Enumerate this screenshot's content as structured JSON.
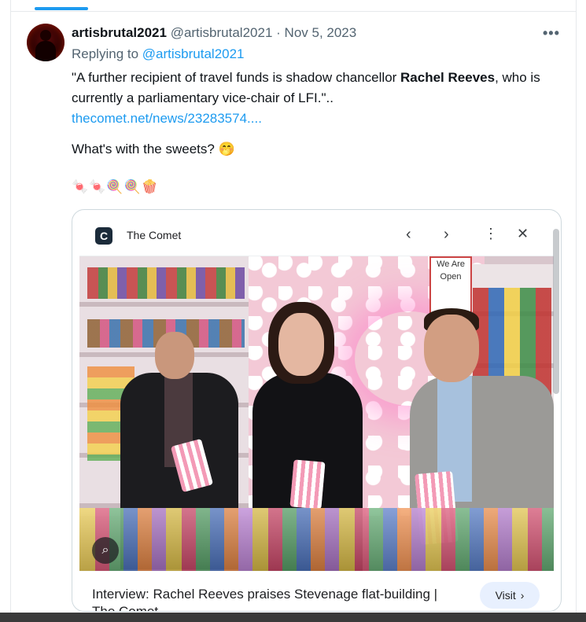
{
  "tweet": {
    "author_name": "artisbrutal2021",
    "author_handle": "@artisbrutal2021",
    "date": "Nov 5, 2023",
    "replying_to_label": "Replying to",
    "replying_to_handle": "@artisbrutal2021",
    "quote_start": "\"A further recipient of travel funds is shadow chancellor ",
    "quote_bold": "Rachel Reeves",
    "quote_end": ", who is currently a parliamentary vice-chair of LFI.\"..",
    "link_text": "thecomet.net/news/23283574....",
    "question_text": "What's with the sweets? 🤭",
    "emoji_row": "🍬🍬🍭🍭🍿",
    "more_icon": "more-options-icon"
  },
  "card": {
    "site_icon_letter": "C",
    "site_name": "The Comet",
    "title": "Interview: Rachel Reeves praises Stevenage flat-building | The Comet",
    "visit_label": "Visit",
    "photo_sign_text": "We Are Open",
    "icons": [
      "back-arrow-icon",
      "forward-arrow-icon",
      "more-vertical-icon",
      "close-icon",
      "lens-search-icon"
    ]
  },
  "colors": {
    "accent": "#1d9bf0",
    "secondary_text": "#536471",
    "visit_button_bg": "#e8f0fe"
  }
}
